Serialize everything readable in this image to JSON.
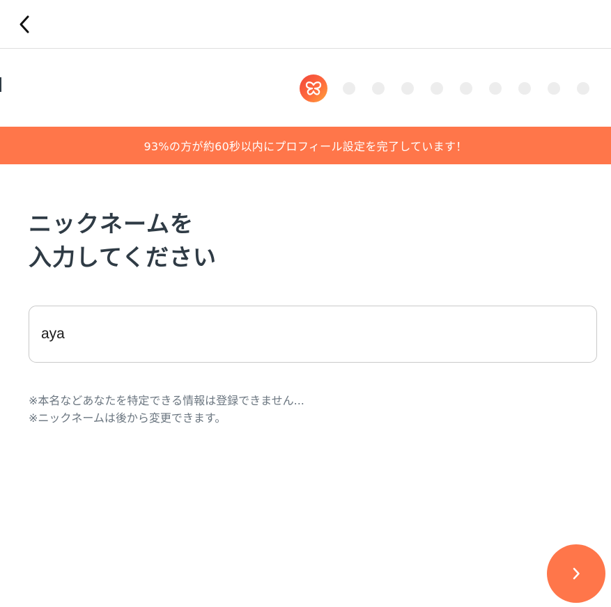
{
  "header": {
    "back_icon": "chevron-left-icon"
  },
  "progress": {
    "logo_icon": "butterfly-logo-icon",
    "current_step": 1,
    "total_steps": 10,
    "active_color": "#ff764a",
    "inactive_color": "#ededed"
  },
  "banner": {
    "text": "93%の方が約60秒以内にプロフィール設定を完了しています！",
    "color": "#ff764a"
  },
  "main": {
    "heading_line1": "ニックネームを",
    "heading_line2": "入力してください",
    "input_value": "aya",
    "note1": "※本名などあなたを特定できる情報は登録できません...",
    "note2": "※ニックネームは後から変更できます。"
  },
  "footer": {
    "next_icon": "chevron-right-icon"
  }
}
